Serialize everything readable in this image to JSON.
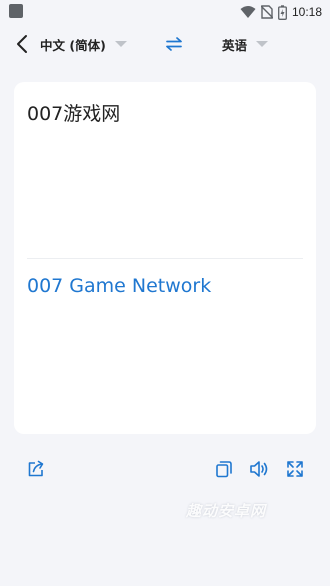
{
  "status_bar": {
    "time": "10:18",
    "icons": [
      "notification-icon",
      "wifi-icon",
      "no-sim-icon",
      "battery-charging-icon"
    ]
  },
  "toolbar": {
    "back_icon": "chevron-left-icon",
    "source_language": "中文 (简体)",
    "target_language": "英语",
    "swap_icon": "swap-arrows-icon"
  },
  "card": {
    "source_text": "007游戏网",
    "translated_text": "007 Game Network"
  },
  "actions": {
    "share_icon": "share-icon",
    "copy_icon": "copy-icon",
    "speaker_icon": "speaker-icon",
    "fullscreen_icon": "fullscreen-icon"
  },
  "watermark": "趣动安卓网",
  "colors": {
    "accent": "#1f77d0",
    "background": "#f4f5f9",
    "card": "#ffffff"
  }
}
